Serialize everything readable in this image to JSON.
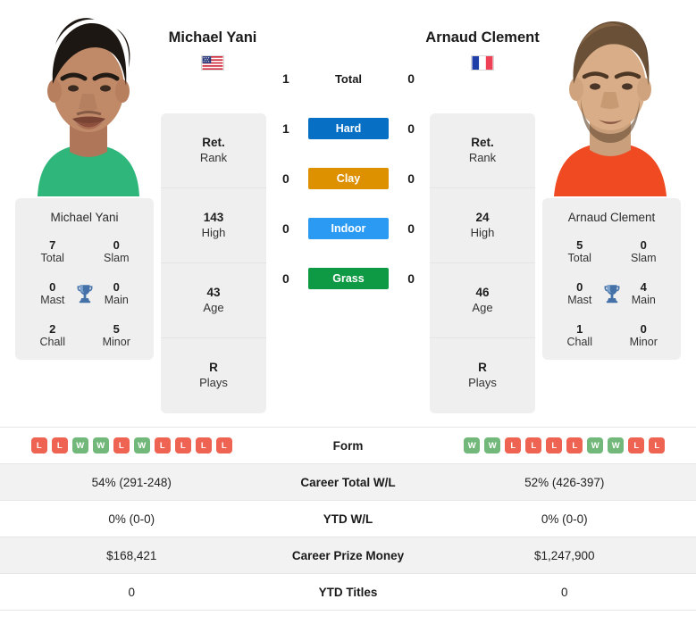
{
  "players": {
    "left": {
      "name": "Michael Yani",
      "country_flag": "us-flag-icon",
      "card_name": "Michael Yani",
      "titles": [
        {
          "num": "7",
          "label": "Total"
        },
        {
          "num": "0",
          "label": "Slam"
        },
        {
          "num": "0",
          "label": "Mast"
        },
        {
          "num": "0",
          "label": "Main"
        },
        {
          "num": "2",
          "label": "Chall"
        },
        {
          "num": "5",
          "label": "Minor"
        }
      ],
      "stats": [
        {
          "num": "Ret.",
          "label": "Rank"
        },
        {
          "num": "143",
          "label": "High"
        },
        {
          "num": "43",
          "label": "Age"
        },
        {
          "num": "R",
          "label": "Plays"
        }
      ],
      "form": [
        "L",
        "L",
        "W",
        "W",
        "L",
        "W",
        "L",
        "L",
        "L",
        "L"
      ],
      "career_total_wl": "54% (291-248)",
      "ytd_wl": "0% (0-0)",
      "career_prize_money": "$168,421",
      "ytd_titles": "0"
    },
    "right": {
      "name": "Arnaud Clement",
      "country_flag": "fr-flag-icon",
      "card_name": "Arnaud Clement",
      "titles": [
        {
          "num": "5",
          "label": "Total"
        },
        {
          "num": "0",
          "label": "Slam"
        },
        {
          "num": "0",
          "label": "Mast"
        },
        {
          "num": "4",
          "label": "Main"
        },
        {
          "num": "1",
          "label": "Chall"
        },
        {
          "num": "0",
          "label": "Minor"
        }
      ],
      "stats": [
        {
          "num": "Ret.",
          "label": "Rank"
        },
        {
          "num": "24",
          "label": "High"
        },
        {
          "num": "46",
          "label": "Age"
        },
        {
          "num": "R",
          "label": "Plays"
        }
      ],
      "form": [
        "W",
        "W",
        "L",
        "L",
        "L",
        "L",
        "W",
        "W",
        "L",
        "L"
      ],
      "career_total_wl": "52% (426-397)",
      "ytd_wl": "0% (0-0)",
      "career_prize_money": "$1,247,900",
      "ytd_titles": "0"
    }
  },
  "h2h": {
    "total": {
      "label": "Total",
      "left": "1",
      "right": "0"
    },
    "surfaces": [
      {
        "label": "Hard",
        "left": "1",
        "right": "0",
        "color": "#0770c4"
      },
      {
        "label": "Clay",
        "left": "0",
        "right": "0",
        "color": "#dd9000"
      },
      {
        "label": "Indoor",
        "left": "0",
        "right": "0",
        "color": "#2b9af3"
      },
      {
        "label": "Grass",
        "left": "0",
        "right": "0",
        "color": "#0e9a44"
      }
    ]
  },
  "table": {
    "form_label": "Form",
    "career_total_wl_label": "Career Total W/L",
    "ytd_wl_label": "YTD W/L",
    "career_prize_money_label": "Career Prize Money",
    "ytd_titles_label": "YTD Titles"
  },
  "colors": {
    "win": "#72b87a",
    "loss": "#ee6352",
    "trophy": "#4472a8",
    "panel": "#efefef",
    "row_shade": "#f2f2f2"
  }
}
